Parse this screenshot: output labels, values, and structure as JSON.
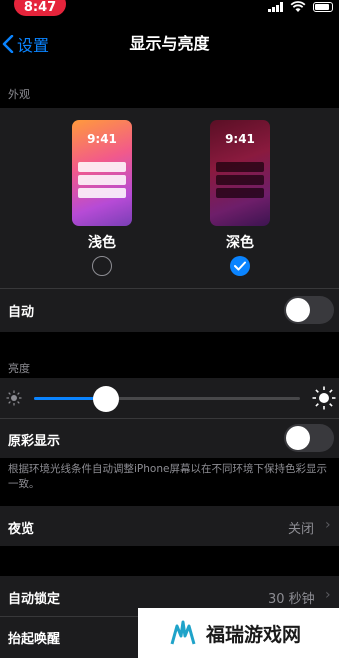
{
  "status_bar": {
    "time": "8:47"
  },
  "nav": {
    "back_label": "设置",
    "title": "显示与亮度"
  },
  "appearance": {
    "header": "外观",
    "light_option": {
      "label": "浅色",
      "preview_time": "9:41",
      "selected": false
    },
    "dark_option": {
      "label": "深色",
      "preview_time": "9:41",
      "selected": true
    },
    "auto": {
      "label": "自动",
      "enabled": false
    }
  },
  "brightness": {
    "header": "亮度",
    "level": 0.27,
    "true_tone": {
      "label": "原彩显示",
      "enabled": false
    },
    "footer": "根据环境光线条件自动调整iPhone屏幕以在不同环境下保持色彩显示一致。"
  },
  "night_shift": {
    "label": "夜览",
    "value": "关闭"
  },
  "auto_lock": {
    "label": "自动锁定",
    "value": "30 秒钟"
  },
  "raise_to_wake": {
    "label": "抬起唤醒"
  },
  "watermark": {
    "text": "福瑞游戏网"
  },
  "colors": {
    "accent": "#0a84ff",
    "background": "#000000",
    "cell": "#1c1c1e"
  }
}
